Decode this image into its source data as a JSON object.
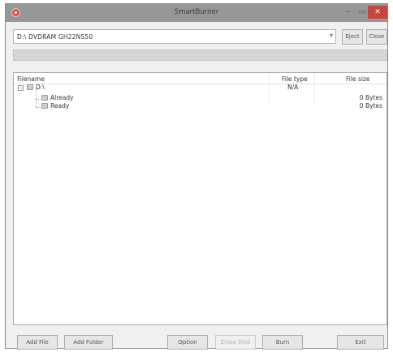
{
  "window": {
    "title": "SmartBurner"
  },
  "titlebar": {
    "minimize": "–",
    "maximize": "▭",
    "close": "✕"
  },
  "drive": {
    "selected": "D:\\ DVDRAM GH22NS50",
    "arrow": "▾"
  },
  "toolbar": {
    "eject_label": "Eject",
    "close_label": "Close"
  },
  "progress": {
    "value": 0
  },
  "filelist": {
    "headers": {
      "filename": "Filename",
      "filetype": "File type",
      "filesize": "File size"
    },
    "rows": [
      {
        "name": "D:\\",
        "type": "N/A",
        "size": ""
      },
      {
        "name": "Already",
        "type": "",
        "size": "0 Bytes"
      },
      {
        "name": "Ready",
        "type": "",
        "size": "0 Bytes"
      }
    ]
  },
  "buttons": {
    "add_file": "Add File",
    "add_folder": "Add Folder",
    "option": "Option",
    "erase_disk": "Erase Disk",
    "burn": "Burn",
    "exit": "Exit"
  },
  "colors": {
    "titlebar": "#979797",
    "close": "#c7453e",
    "progress_fill": "#28a745"
  }
}
